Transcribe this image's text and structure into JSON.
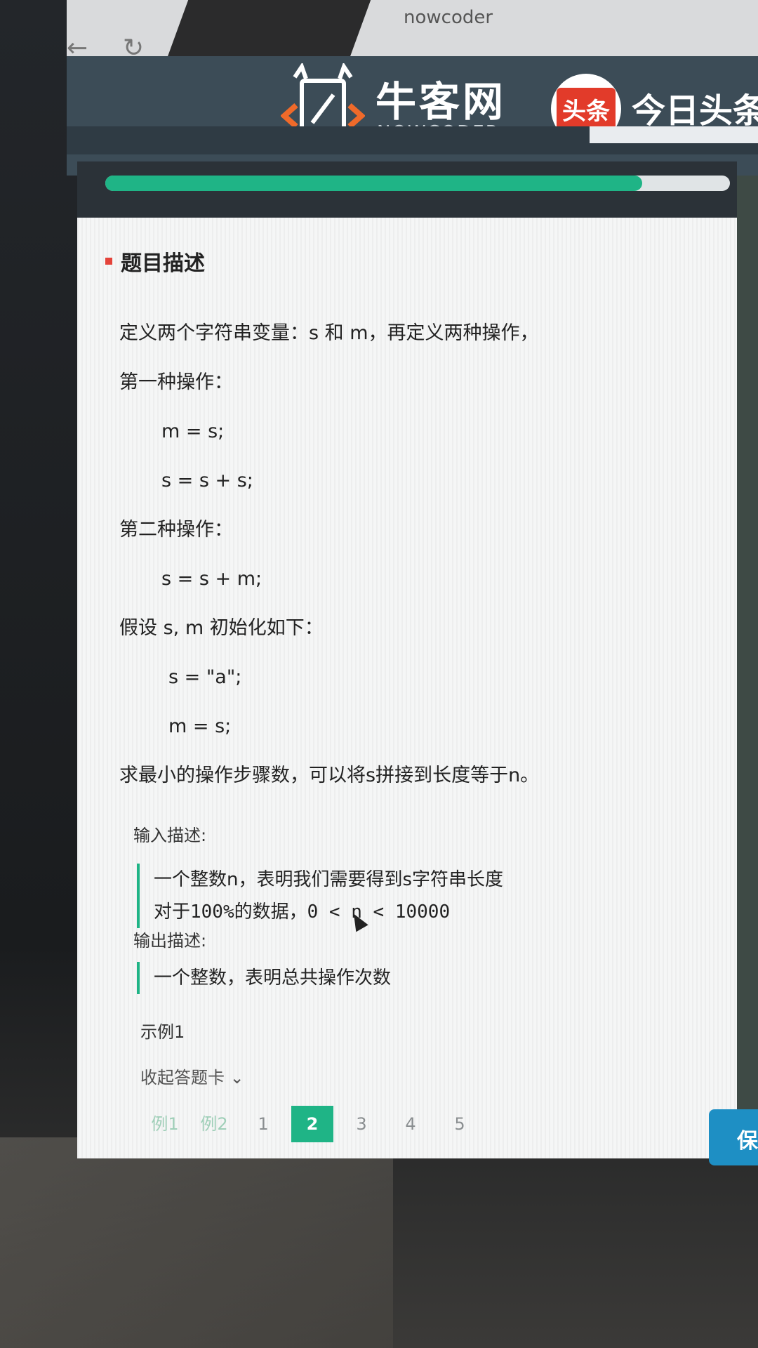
{
  "browser": {
    "back_icon": "back-arrow-icon",
    "reload_icon": "reload-icon",
    "url": "nowcoder"
  },
  "header": {
    "logo_cn": "牛客网",
    "logo_en": "NOWCODER",
    "partner_badge": "头条",
    "partner_name": "今日头条"
  },
  "progress": {
    "fraction": 0.86,
    "color": "#1fb486"
  },
  "problem": {
    "section_title": "题目描述",
    "lines": [
      {
        "text": "定义两个字符串变量：s 和 m，再定义两种操作，",
        "indent": 0
      },
      {
        "text": "第一种操作：",
        "indent": 0
      },
      {
        "text": "m = s;",
        "indent": 1
      },
      {
        "text": "s = s + s;",
        "indent": 1
      },
      {
        "text": "第二种操作：",
        "indent": 0
      },
      {
        "text": "s = s + m;",
        "indent": 1
      },
      {
        "text": "假设 s, m 初始化如下：",
        "indent": 0
      },
      {
        "text": "s = \"a\";",
        "indent": 2
      },
      {
        "text": "m = s;",
        "indent": 2
      },
      {
        "text": "求最小的操作步骤数，可以将s拼接到长度等于n。",
        "indent": 0
      }
    ],
    "input_title": "输入描述:",
    "input_lines": [
      "一个整数n，表明我们需要得到s字符串长度",
      "对于100%的数据，0 < n < 10000"
    ],
    "output_title": "输出描述:",
    "output_text": "一个整数，表明总共操作次数",
    "example_title": "示例1"
  },
  "answer_card": {
    "collapse_label": "收起答题卡 ⌄",
    "pages": [
      {
        "label": "例1",
        "kind": "example"
      },
      {
        "label": "例2",
        "kind": "example"
      },
      {
        "label": "1",
        "kind": "normal"
      },
      {
        "label": "2",
        "kind": "active"
      },
      {
        "label": "3",
        "kind": "normal"
      },
      {
        "label": "4",
        "kind": "normal"
      },
      {
        "label": "5",
        "kind": "normal"
      }
    ]
  },
  "actions": {
    "save_label": "保"
  }
}
